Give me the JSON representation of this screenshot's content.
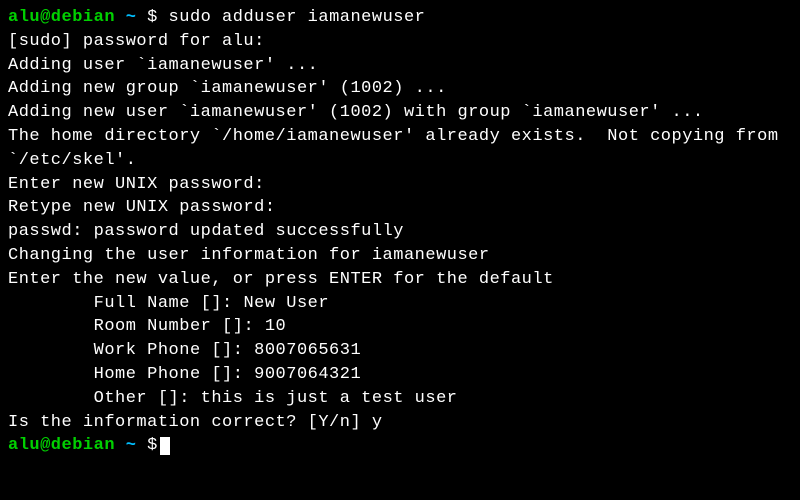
{
  "prompt1": {
    "user_host": "alu@debian",
    "path": "~",
    "symbol": "$",
    "command": "sudo adduser iamanewuser"
  },
  "output": {
    "l1": "[sudo] password for alu:",
    "l2": "Adding user `iamanewuser' ...",
    "l3": "Adding new group `iamanewuser' (1002) ...",
    "l4": "Adding new user `iamanewuser' (1002) with group `iamanewuser' ...",
    "l5": "The home directory `/home/iamanewuser' already exists.  Not copying from `/etc/skel'.",
    "l6": "Enter new UNIX password:",
    "l7": "Retype new UNIX password:",
    "l8": "passwd: password updated successfully",
    "l9": "Changing the user information for iamanewuser",
    "l10": "Enter the new value, or press ENTER for the default",
    "l11": "        Full Name []: New User",
    "l12": "        Room Number []: 10",
    "l13": "        Work Phone []: 8007065631",
    "l14": "        Home Phone []: 9007064321",
    "l15": "        Other []: this is just a test user",
    "l16": "Is the information correct? [Y/n] y"
  },
  "prompt2": {
    "user_host": "alu@debian",
    "path": "~",
    "symbol": "$"
  }
}
